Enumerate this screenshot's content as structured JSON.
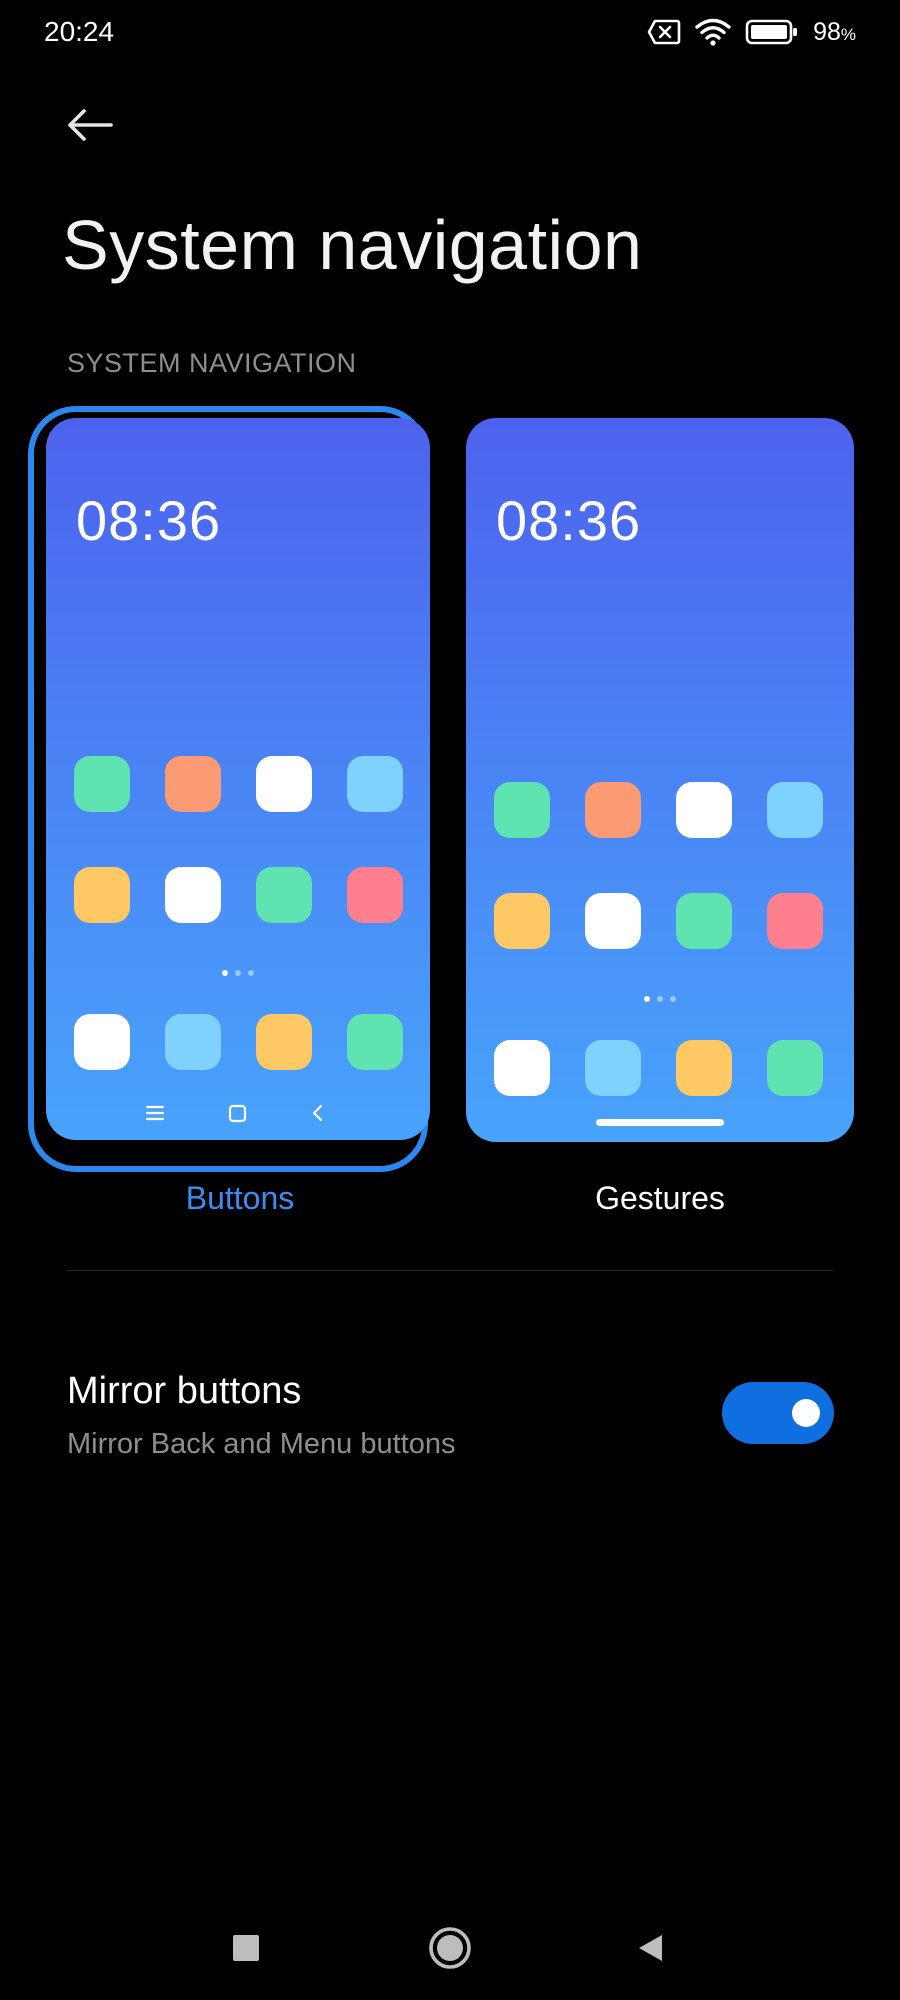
{
  "status_bar": {
    "time": "20:24",
    "battery_percent": "98",
    "battery_unit": "%",
    "icons": [
      "no-sim-icon",
      "wifi-icon",
      "battery-icon"
    ]
  },
  "header": {
    "title": "System navigation",
    "section_label": "SYSTEM NAVIGATION"
  },
  "options": [
    {
      "label": "Buttons",
      "selected": true,
      "preview_clock": "08:36",
      "nav_icons": [
        "menu-icon",
        "home-square-icon",
        "back-chevron-icon"
      ]
    },
    {
      "label": "Gestures",
      "selected": false,
      "preview_clock": "08:36",
      "nav_icons": [
        "gesture-bar"
      ]
    }
  ],
  "preview_app_colors": {
    "grid": [
      "#5fe3b0",
      "#fb9a73",
      "#ffffff",
      "#7ed2fd",
      "#fec964",
      "#ffffff",
      "#5fe3b0",
      "#fe7f8e"
    ],
    "dock": [
      "#ffffff",
      "#7ed2fd",
      "#fec964",
      "#5fe3b0"
    ]
  },
  "mirror_buttons": {
    "title": "Mirror buttons",
    "subtitle": "Mirror Back and Menu buttons",
    "enabled": true
  },
  "theme": {
    "accent": "#2c87f0",
    "toggle_on": "#0f6fe0",
    "background": "#000000",
    "secondary_text": "#8e8e8e"
  },
  "system_nav_icons": [
    "recents-square-icon",
    "home-circle-icon",
    "back-triangle-icon"
  ]
}
